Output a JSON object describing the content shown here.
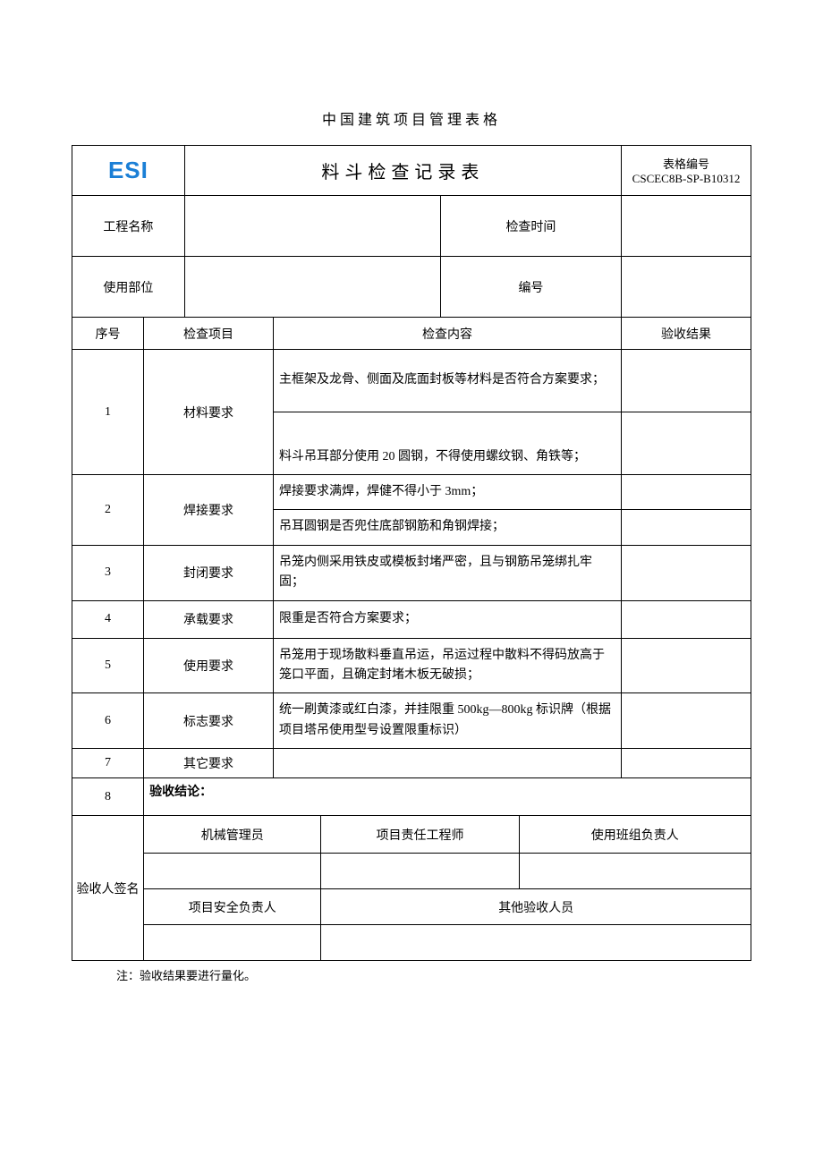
{
  "page_heading": "中国建筑项目管理表格",
  "logo_text": "ESI",
  "form_title": "料斗检查记录表",
  "form_number_label": "表格编号",
  "form_number_code": "CSCEC8B-SP-B10312",
  "labels": {
    "project_name": "工程名称",
    "check_time": "检查时间",
    "use_part": "使用部位",
    "code": "编号",
    "seq": "序号",
    "check_item": "检查项目",
    "check_content": "检查内容",
    "result": "验收结果"
  },
  "rows": [
    {
      "no": "1",
      "item": "材料要求",
      "contents": [
        "主框架及龙骨、侧面及底面封板等材料是否符合方案要求；",
        "料斗吊耳部分使用 20 圆钢，不得使用螺纹钢、角铁等；"
      ]
    },
    {
      "no": "2",
      "item": "焊接要求",
      "contents": [
        "焊接要求满焊，焊健不得小于 3mm；",
        "吊耳圆钢是否兜住底部钢筋和角钢焊接；"
      ]
    },
    {
      "no": "3",
      "item": "封闭要求",
      "contents": [
        "吊笼内侧采用铁皮或模板封堵严密，且与钢筋吊笼绑扎牢固；"
      ]
    },
    {
      "no": "4",
      "item": "承载要求",
      "contents": [
        "限重是否符合方案要求；"
      ]
    },
    {
      "no": "5",
      "item": "使用要求",
      "contents": [
        "吊笼用于现场散料垂直吊运，吊运过程中散料不得码放高于笼口平面，且确定封堵木板无破损；"
      ]
    },
    {
      "no": "6",
      "item": "标志要求",
      "contents": [
        "统一刷黄漆或红白漆，并挂限重 500kg—800kg 标识牌（根据项目塔吊使用型号设置限重标识）"
      ]
    },
    {
      "no": "7",
      "item": "其它要求",
      "contents": [
        ""
      ]
    }
  ],
  "conclusion": {
    "no": "8",
    "label": "验收结论："
  },
  "signatures": {
    "section_label": "验收人签名",
    "roles": {
      "mech_mgr": "机械管理员",
      "proj_engineer": "项目责任工程师",
      "team_leader": "使用班组负责人",
      "safety_mgr": "项目安全负责人",
      "other": "其他验收人员"
    }
  },
  "note": "注：验收结果要进行量化。"
}
